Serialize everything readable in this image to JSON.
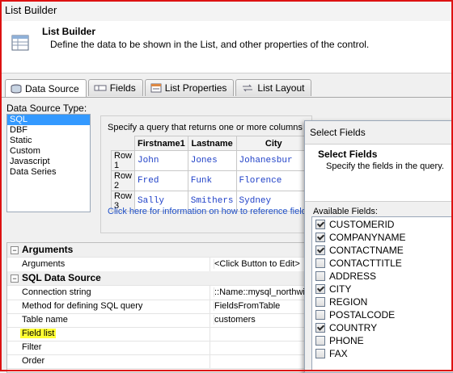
{
  "window": {
    "title": "List Builder"
  },
  "header": {
    "title": "List Builder",
    "description": "Define the data to be shown in the List, and other properties of the control."
  },
  "tabs": [
    {
      "label": "Data Source",
      "icon": "database-icon",
      "active": true
    },
    {
      "label": "Fields",
      "icon": "fields-icon",
      "active": false
    },
    {
      "label": "List Properties",
      "icon": "properties-icon",
      "active": false
    },
    {
      "label": "List Layout",
      "icon": "layout-icon",
      "active": false
    }
  ],
  "data_source": {
    "label": "Data Source Type:",
    "options": [
      "SQL",
      "DBF",
      "Static",
      "Custom",
      "Javascript",
      "Data Series"
    ],
    "selected": "SQL"
  },
  "query_panel": {
    "instruction": "Specify a query that returns one or more columns",
    "columns": [
      "Firstname1",
      "Lastname",
      "City"
    ],
    "rows": [
      {
        "label": "Row 1",
        "values": [
          "John",
          "Jones",
          "Johanesbur"
        ]
      },
      {
        "label": "Row 2",
        "values": [
          "Fred",
          "Funk",
          "Florence"
        ]
      },
      {
        "label": "Row 3",
        "values": [
          "Sally",
          "Smithers",
          "Sydney"
        ]
      }
    ],
    "link": "Click here for information on how to reference field"
  },
  "properties": {
    "categories": [
      {
        "name": "Arguments",
        "items": [
          {
            "name": "Arguments",
            "value": "<Click Button to Edit>"
          }
        ]
      },
      {
        "name": "SQL Data Source",
        "items": [
          {
            "name": "Connection string",
            "value": "::Name::mysql_northwin"
          },
          {
            "name": "Method for defining SQL query",
            "value": "FieldsFromTable"
          },
          {
            "name": "Table name",
            "value": "customers"
          },
          {
            "name": "Field list",
            "value": ""
          },
          {
            "name": "Filter",
            "value": ""
          },
          {
            "name": "Order",
            "value": ""
          }
        ]
      }
    ]
  },
  "select_fields_dialog": {
    "title": "Select Fields",
    "heading": "Select Fields",
    "subheading": "Specify the fields in the query.",
    "available_label": "Available Fields:",
    "fields": [
      {
        "name": "CUSTOMERID",
        "checked": true
      },
      {
        "name": "COMPANYNAME",
        "checked": true
      },
      {
        "name": "CONTACTNAME",
        "checked": true
      },
      {
        "name": "CONTACTTITLE",
        "checked": false
      },
      {
        "name": "ADDRESS",
        "checked": false
      },
      {
        "name": "CITY",
        "checked": true
      },
      {
        "name": "REGION",
        "checked": false
      },
      {
        "name": "POSTALCODE",
        "checked": false
      },
      {
        "name": "COUNTRY",
        "checked": true
      },
      {
        "name": "PHONE",
        "checked": false
      },
      {
        "name": "FAX",
        "checked": false
      }
    ]
  },
  "colors": {
    "selection": "#3399ff",
    "link": "#2050c8",
    "highlight": "#ffff33",
    "frame": "#dd1111"
  }
}
